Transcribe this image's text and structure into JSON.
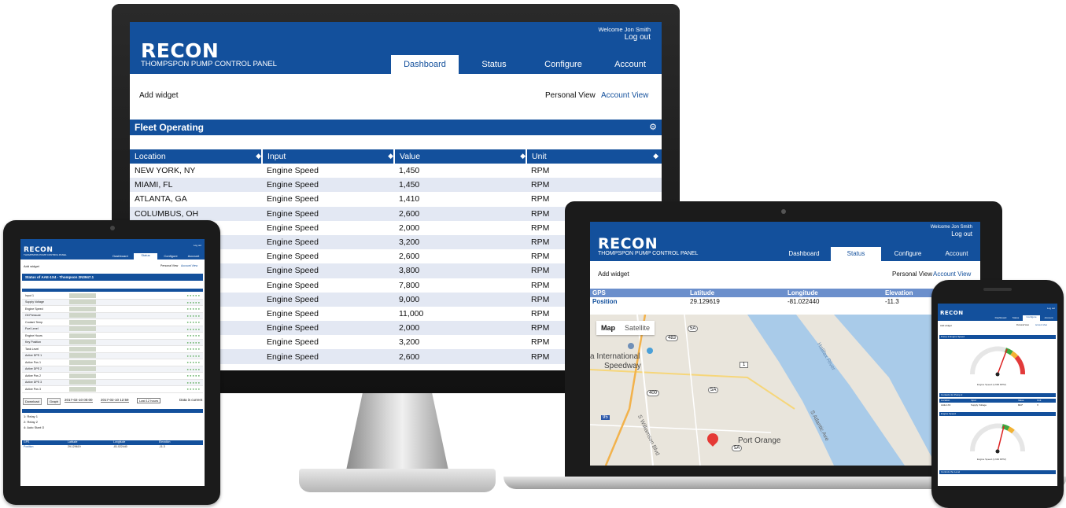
{
  "app": {
    "logo": "RECON",
    "subtitle": "THOMPSPON PUMP CONTROL PANEL",
    "welcome": "Welcome Jon Smith",
    "logout": "Log out",
    "tabs": [
      "Dashboard",
      "Status",
      "Configure",
      "Account"
    ],
    "add_widget": "Add widget",
    "personal_view": "Personal View",
    "account_view": "Account View"
  },
  "colors": {
    "brand": "#13509c",
    "row_alt": "#e3e8f3",
    "map_water": "#a9cbe9",
    "pin": "#e53935"
  },
  "desktop": {
    "widget_title": "Fleet Operating",
    "settings_icon": "gear-icon",
    "columns": [
      "Location",
      "Input",
      "Value",
      "Unit"
    ],
    "rows": [
      [
        "NEW YORK, NY",
        "Engine Speed",
        "1,450",
        "RPM"
      ],
      [
        "MIAMI, FL",
        "Engine Speed",
        "1,450",
        "RPM"
      ],
      [
        "ATLANTA, GA",
        "Engine Speed",
        "1,410",
        "RPM"
      ],
      [
        "COLUMBUS, OH",
        "Engine Speed",
        "2,600",
        "RPM"
      ],
      [
        "",
        "Engine Speed",
        "2,000",
        "RPM"
      ],
      [
        "",
        "Engine Speed",
        "3,200",
        "RPM"
      ],
      [
        "",
        "Engine Speed",
        "2,600",
        "RPM"
      ],
      [
        "",
        "Engine Speed",
        "3,800",
        "RPM"
      ],
      [
        "",
        "Engine Speed",
        "7,800",
        "RPM"
      ],
      [
        "",
        "Engine Speed",
        "9,000",
        "RPM"
      ],
      [
        "",
        "Engine Speed",
        "11,000",
        "RPM"
      ],
      [
        "",
        "Engine Speed",
        "2,000",
        "RPM"
      ],
      [
        "",
        "Engine Speed",
        "3,200",
        "RPM"
      ],
      [
        "",
        "Engine Speed",
        "2,600",
        "RPM"
      ]
    ]
  },
  "laptop": {
    "gps_columns": [
      "GPS",
      "Latitude",
      "Longitude",
      "Elevation"
    ],
    "gps_row": [
      "Position",
      "29.129619",
      "-81.022440",
      "-11.3"
    ],
    "map_buttons": [
      "Map",
      "Satellite"
    ],
    "map_labels": [
      "a International",
      "Speedway",
      "Port Orange",
      "Halifax River",
      "S Atlantic Ave",
      "S Williamson Blvd"
    ],
    "road_shields": [
      "483",
      "5A",
      "1",
      "400",
      "5A",
      "95",
      "5A"
    ]
  },
  "tablet": {
    "title": "Status of AAE-1X4 - Thompson 2N3947.1",
    "inputs": [
      "Input 1",
      "Supply Voltage",
      "Engine Speed",
      "Oil Pressure",
      "Coolant Temp",
      "Fuel Level",
      "Engine Hours",
      "Key Position",
      "Tank Level",
      "Active DPS 1",
      "Active Pos 1",
      "Active DPS 2",
      "Active Pos 2",
      "Active DPS 3",
      "Active Pos 3"
    ],
    "download": "Download",
    "graph": "Graph",
    "from_date": "2017-02-10 00:00",
    "to_date": "2017-02-10 12:59",
    "quick_preset": "Last 12 hours",
    "data_status": "Data is current",
    "outputs": [
      "1: Relay 1",
      "2: Relay 2",
      "4: Auto Start O"
    ],
    "gps_columns": [
      "GPS",
      "Latitude",
      "Longitude",
      "Elevation"
    ],
    "gps_row": [
      "Position",
      "29.129619",
      "-81.022440",
      "-11.3"
    ]
  },
  "phone": {
    "gauge1_title": "Pump 2 Engine Speed",
    "gauge1_caption": "Engine Speed (1,690 RPM)",
    "table_title": "Contacts for Pump 2",
    "table_columns": [
      "Location",
      "Input",
      "Value",
      "Unit"
    ],
    "table_row": [
      "AAE-1X4",
      "Supply Voltage",
      "12.7",
      "V"
    ],
    "gauge2_title": "Engine Speed",
    "gauge2_caption": "Engine Speed (1,690 RPM)",
    "section3": "Controls the Level"
  }
}
